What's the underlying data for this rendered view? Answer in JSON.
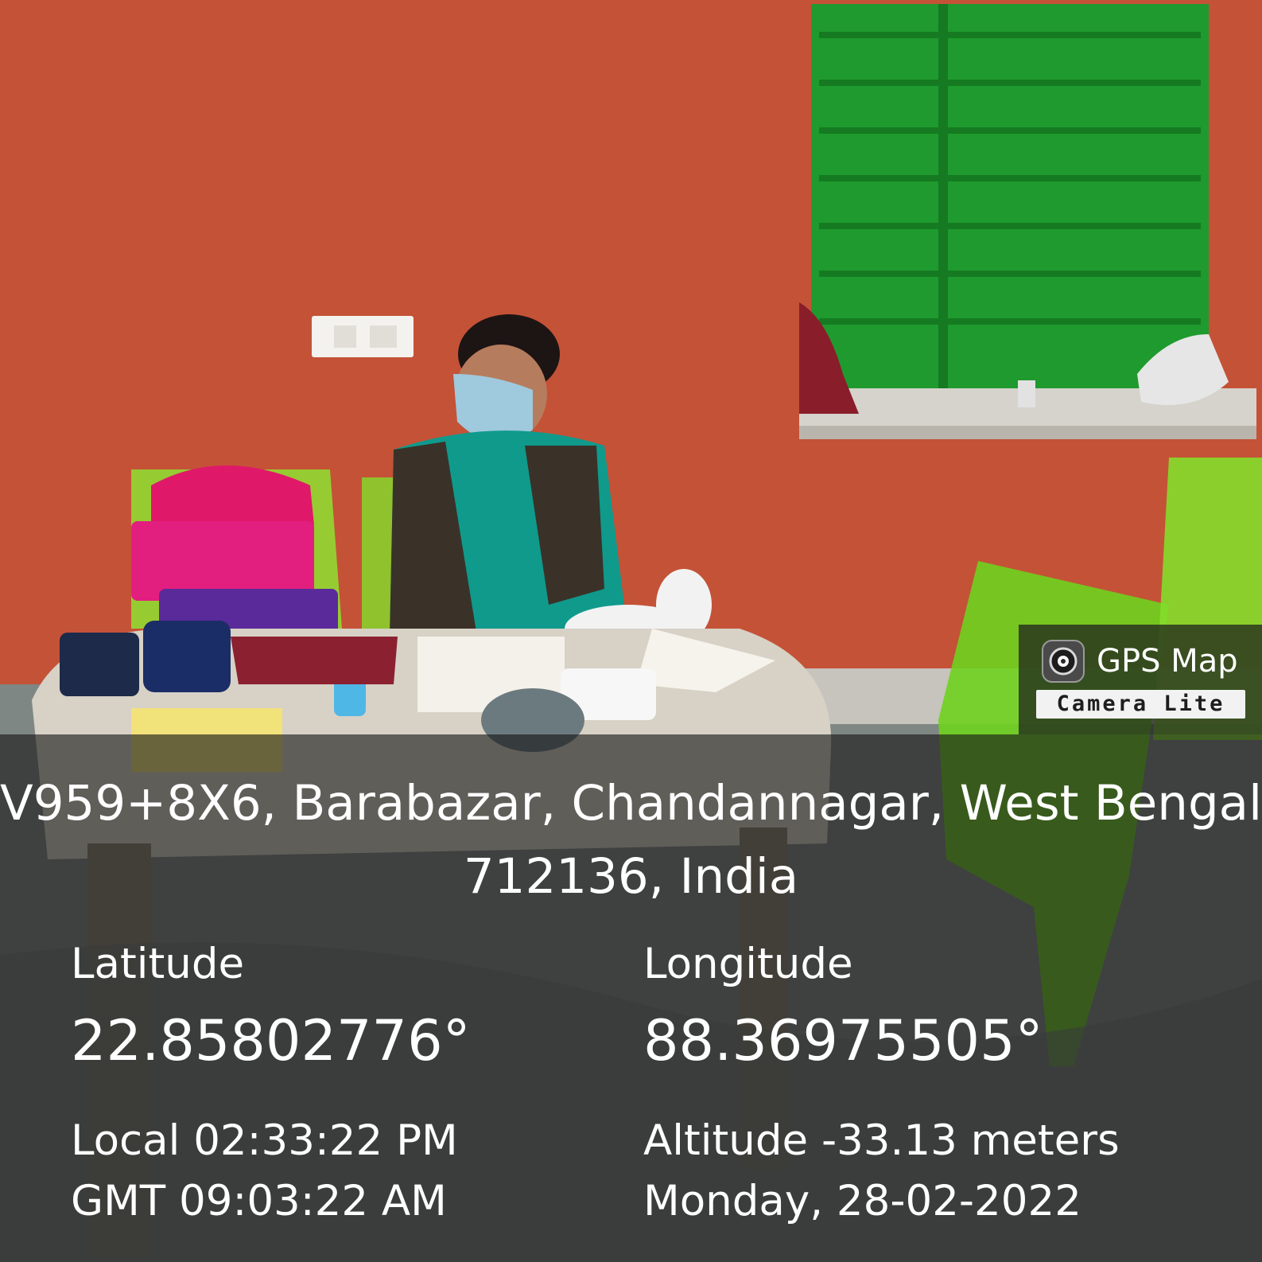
{
  "badge": {
    "title": "GPS Map",
    "subtitle": "Camera Lite",
    "icon": "camera-lens-icon"
  },
  "location": {
    "address": "V959+8X6, Barabazar, Chandannagar, West Bengal 712136, India",
    "latitude_label": "Latitude",
    "latitude_value": "22.85802776°",
    "longitude_label": "Longitude",
    "longitude_value": "88.36975505°",
    "local_time": "Local 02:33:22 PM",
    "gmt_time": "GMT 09:03:22 AM",
    "altitude": "Altitude -33.13 meters",
    "date": "Monday, 28-02-2022"
  },
  "colors": {
    "wall": "#c9553a",
    "shutter": "#1f9a2e",
    "chair": "#7fdc2a",
    "overlay": "#161616"
  }
}
